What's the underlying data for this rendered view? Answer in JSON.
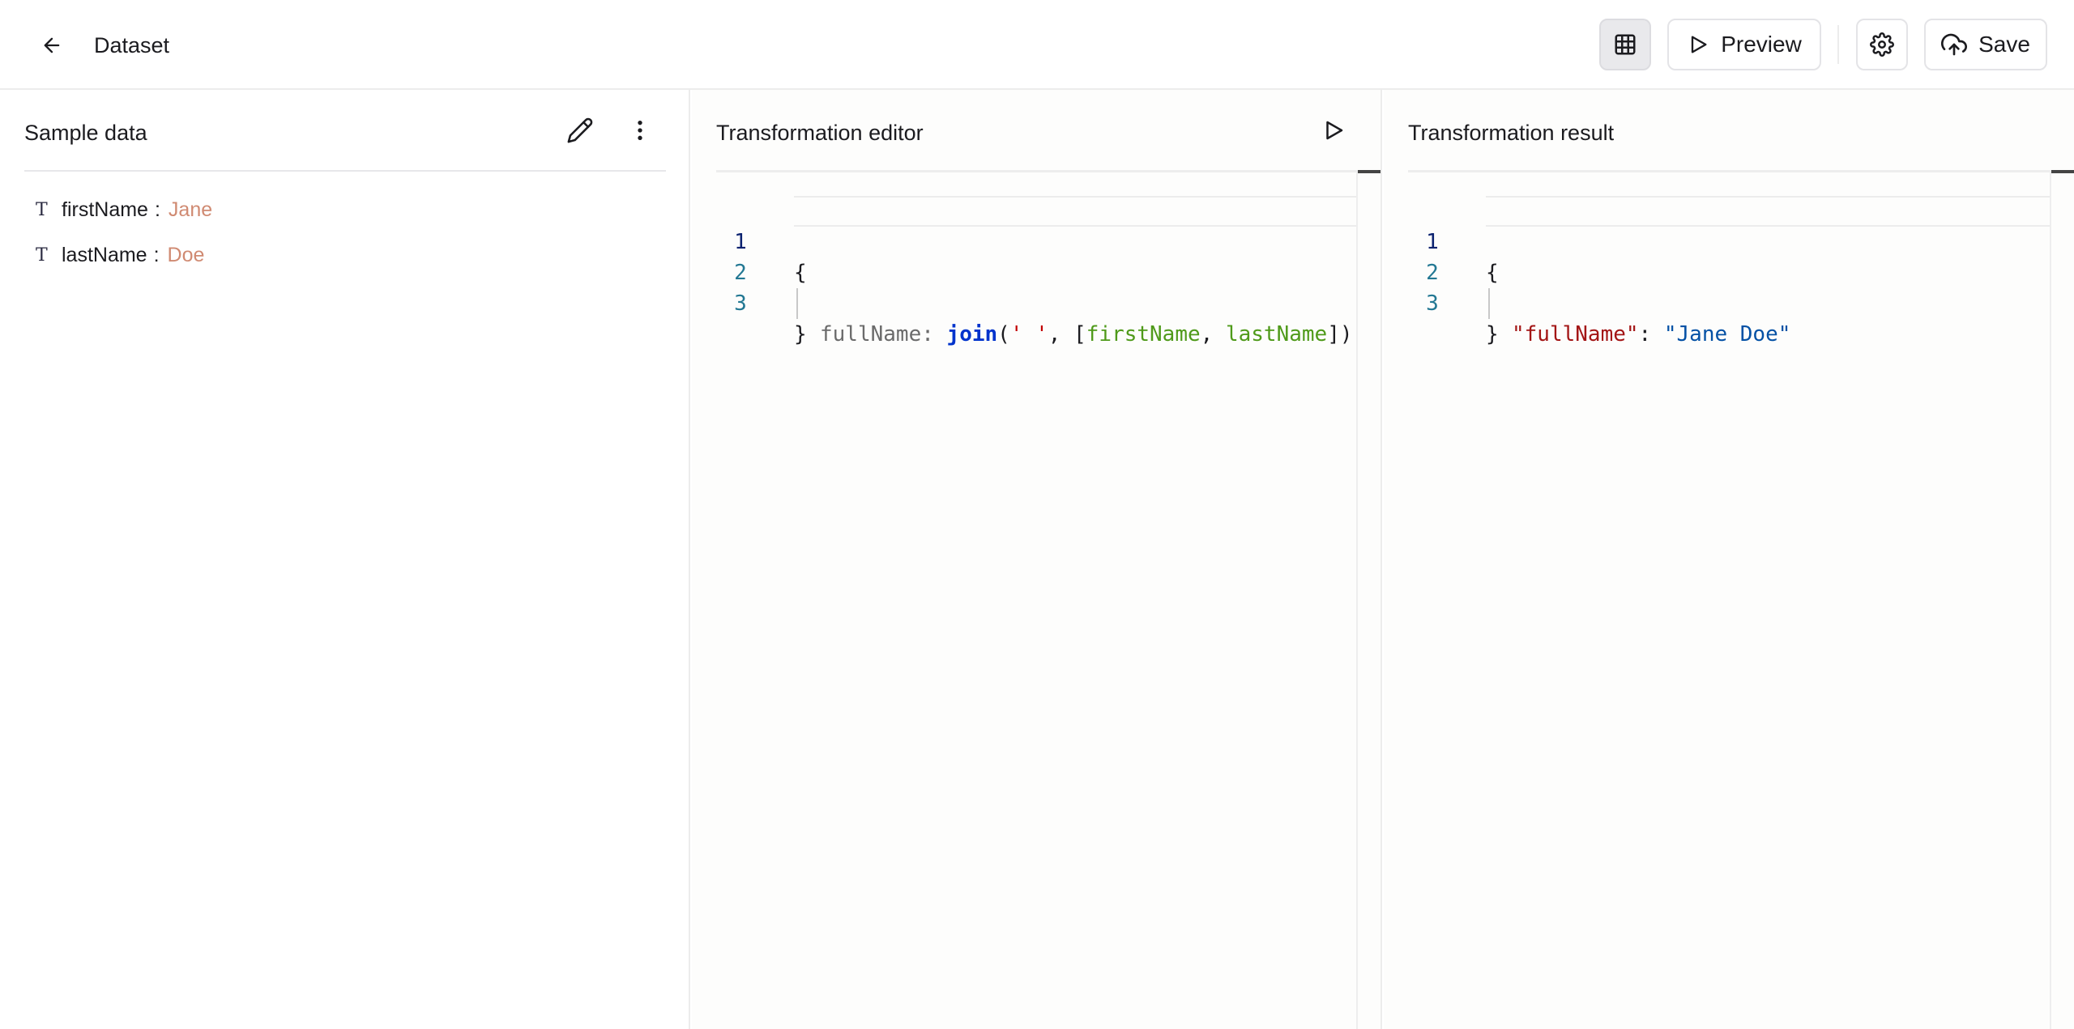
{
  "header": {
    "title": "Dataset",
    "preview_label": "Preview",
    "save_label": "Save"
  },
  "sample_panel": {
    "title": "Sample data",
    "fields": [
      {
        "type_icon": "T",
        "name": "firstName",
        "colon": ":",
        "value": "Jane"
      },
      {
        "type_icon": "T",
        "name": "lastName",
        "colon": ":",
        "value": "Doe"
      }
    ]
  },
  "editor_panel": {
    "title": "Transformation editor",
    "lines": [
      {
        "num": "1",
        "open": "{"
      },
      {
        "num": "2",
        "key": "fullName",
        "sep": ": ",
        "fn": "join",
        "p1": "(",
        "str": "' '",
        "comma1": ", ",
        "br1": "[",
        "var1": "firstName",
        "comma2": ", ",
        "var2": "lastName",
        "br2": "])"
      },
      {
        "num": "3",
        "close": "}"
      }
    ]
  },
  "result_panel": {
    "title": "Transformation result",
    "lines": [
      {
        "num": "1",
        "open": "{"
      },
      {
        "num": "2",
        "key": "\"fullName\"",
        "sep": ": ",
        "value": "\"Jane Doe\""
      },
      {
        "num": "3",
        "close": "}"
      }
    ]
  },
  "colors": {
    "accent_value": "#d08a72",
    "code_function": "#0033cc",
    "code_string": "#c20000",
    "code_variable": "#4f9a1a",
    "json_key": "#a31515",
    "json_value": "#0451a5"
  },
  "icons": {
    "back": "arrow-left-icon",
    "grid": "table-grid-icon",
    "preview": "play-icon",
    "settings": "gear-icon",
    "save": "cloud-upload-icon",
    "edit": "pencil-icon",
    "more": "more-vertical-icon",
    "run": "play-icon"
  }
}
